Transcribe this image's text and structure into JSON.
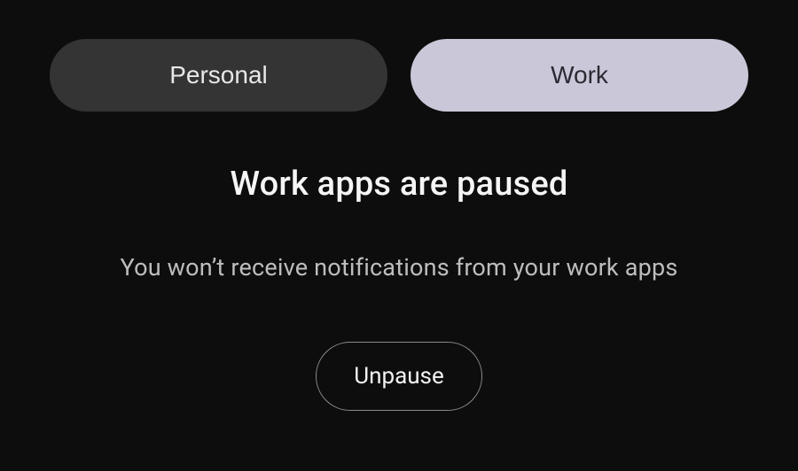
{
  "tabs": {
    "personal": "Personal",
    "work": "Work",
    "active": "work"
  },
  "content": {
    "heading": "Work apps are paused",
    "subtext": "You won’t receive notifications from your work apps",
    "unpause_label": "Unpause"
  }
}
